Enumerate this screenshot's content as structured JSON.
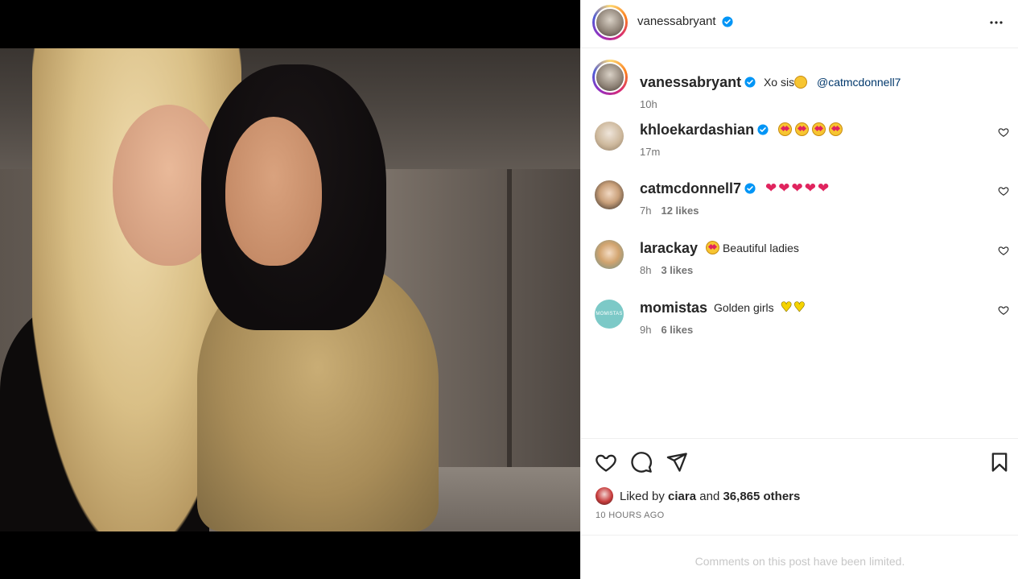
{
  "post": {
    "author": "vanessabryant",
    "caption_text": "Xo sis",
    "caption_mention": "@catmcdonnell7",
    "caption_time": "10h",
    "more_icon": "more-horizontal-icon"
  },
  "comments": [
    {
      "username": "khloekardashian",
      "verified": true,
      "emojis": [
        "heart-eyes",
        "heart-eyes",
        "heart-eyes",
        "heart-eyes"
      ],
      "text": "",
      "time": "17m",
      "likes": ""
    },
    {
      "username": "catmcdonnell7",
      "verified": true,
      "emojis": [
        "red-heart",
        "red-heart",
        "red-heart",
        "red-heart",
        "red-heart"
      ],
      "text": "",
      "time": "7h",
      "likes": "12 likes"
    },
    {
      "username": "larackay",
      "verified": false,
      "emojis": [
        "heart-eyes"
      ],
      "text": "Beautiful ladies",
      "time": "8h",
      "likes": "3 likes"
    },
    {
      "username": "momistas",
      "verified": false,
      "emojis": [],
      "text": "Golden girls",
      "trailing_emojis": [
        "yellow-heart",
        "yellow-heart"
      ],
      "time": "9h",
      "likes": "6 likes"
    }
  ],
  "actions": {
    "like_icon": "heart-icon",
    "comment_icon": "comment-icon",
    "share_icon": "send-icon",
    "save_icon": "bookmark-icon"
  },
  "likes": {
    "prefix": "Liked by",
    "user": "ciara",
    "connector": "and",
    "others": "36,865 others"
  },
  "post_time": "10 HOURS AGO",
  "comments_limited": "Comments on this post have been limited.",
  "momistas_avatar_text": "MOMISTAS",
  "colors": {
    "verified": "#0095f6",
    "text": "#262626",
    "muted": "#737373",
    "mention": "#00376b"
  }
}
